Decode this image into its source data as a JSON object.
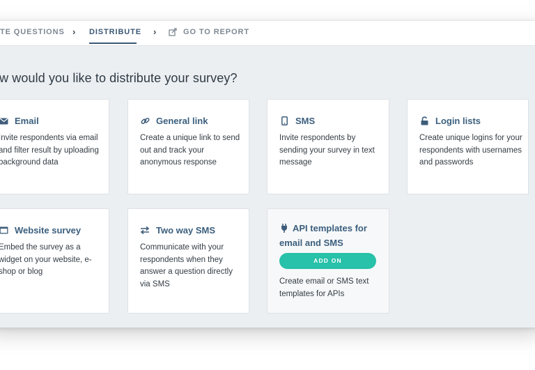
{
  "nav": {
    "step_questions": "TE QUESTIONS",
    "step_distribute": "DISTRIBUTE",
    "step_report": "GO TO REPORT",
    "chevron": "›"
  },
  "heading": "ow would you like to distribute your survey?",
  "cards": {
    "email": {
      "title": "Email",
      "icon": "envelope-icon",
      "description": "Invite respondents via email and filter result by uploading background data"
    },
    "general_link": {
      "title": "General link",
      "icon": "link-icon",
      "description": "Create a unique link to send out and track your anonymous response"
    },
    "sms": {
      "title": "SMS",
      "icon": "mobile-icon",
      "description": "Invite respondents by sending your survey in text message"
    },
    "login_lists": {
      "title": "Login lists",
      "icon": "lock-icon",
      "description": "Create unique logins for your respondents with usernames and passwords"
    },
    "website_survey": {
      "title": "Website survey",
      "icon": "browser-window-icon",
      "description": "Embed the survey as a widget on your website, e-shop or blog"
    },
    "two_way_sms": {
      "title": "Two way SMS",
      "icon": "exchange-arrows-icon",
      "description": "Communicate with your respondents when they answer a question directly via SMS"
    },
    "api_templates": {
      "title": "API templates for email and SMS",
      "icon": "plug-icon",
      "button_label": "ADD ON",
      "description": "Create email or SMS text templates for APIs"
    }
  },
  "colors": {
    "accent": "#3b5f7e",
    "addon": "#28c1a9",
    "background": "#eceff2"
  }
}
